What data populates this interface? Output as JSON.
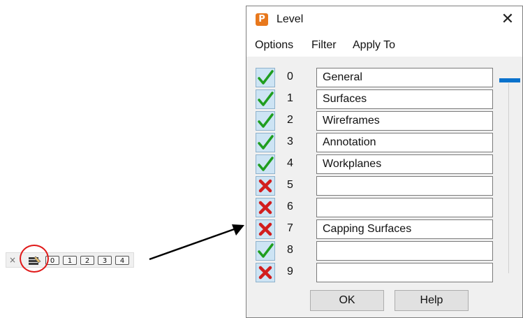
{
  "toolbar": {
    "close_label": "×",
    "level_buttons": [
      "0",
      "1",
      "2",
      "3",
      "4"
    ],
    "level_icon": "level-icon"
  },
  "dialog": {
    "title": "Level",
    "app_icon_letter": "P",
    "close_label": "✕",
    "menu": [
      "Options",
      "Filter",
      "Apply To"
    ],
    "levels": [
      {
        "num": "0",
        "name": "General",
        "visible": true
      },
      {
        "num": "1",
        "name": "Surfaces",
        "visible": true
      },
      {
        "num": "2",
        "name": "Wireframes",
        "visible": true
      },
      {
        "num": "3",
        "name": "Annotation",
        "visible": true
      },
      {
        "num": "4",
        "name": "Workplanes",
        "visible": true
      },
      {
        "num": "5",
        "name": "",
        "visible": false
      },
      {
        "num": "6",
        "name": "",
        "visible": false
      },
      {
        "num": "7",
        "name": "Capping Surfaces",
        "visible": false
      },
      {
        "num": "8",
        "name": "",
        "visible": true
      },
      {
        "num": "9",
        "name": "",
        "visible": false
      }
    ],
    "ok_label": "OK",
    "help_label": "Help"
  },
  "colors": {
    "accent": "#0a72cc",
    "highlight_circle": "#e01818",
    "check_green": "#1f9e1f",
    "cross_red": "#d21e1e",
    "app_icon": "#e8781c"
  }
}
